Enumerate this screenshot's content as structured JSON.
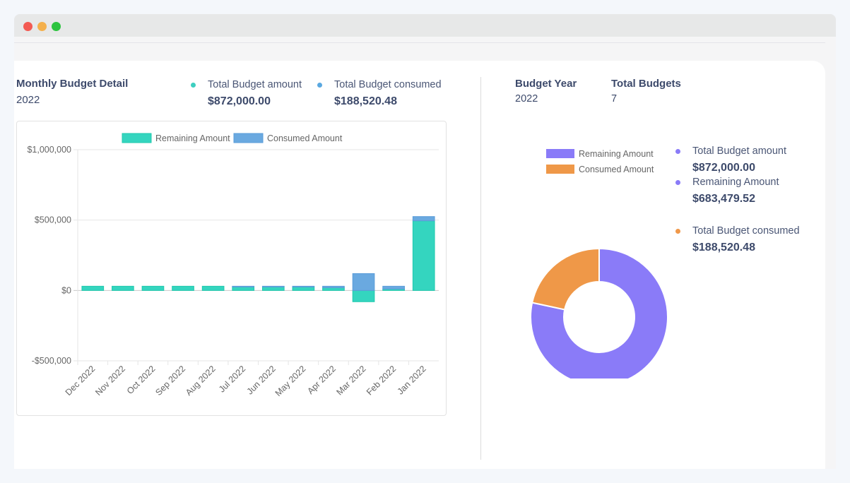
{
  "window": {
    "controls": [
      "close",
      "minimize",
      "maximize"
    ]
  },
  "left_panel": {
    "title": "Monthly Budget Detail",
    "year": "2022",
    "stats": [
      {
        "label": "Total Budget amount",
        "value": "$872,000.00",
        "dot_color": "#3ecfc0"
      },
      {
        "label": "Total Budget consumed",
        "value": "$188,520.48",
        "dot_color": "#5aa8e0"
      }
    ]
  },
  "right_panel": {
    "budget_year_label": "Budget Year",
    "budget_year_value": "2022",
    "total_budgets_label": "Total Budgets",
    "total_budgets_value": "7",
    "stats": [
      {
        "label": "Total Budget amount",
        "value": "$872,000.00",
        "dot_color": "#8a7bf8"
      },
      {
        "label": "Remaining Amount",
        "value": "$683,479.52",
        "dot_color": "#8a7bf8"
      },
      {
        "label": "Total Budget consumed",
        "value": "$188,520.48",
        "dot_color": "#f0984a"
      }
    ]
  },
  "chart_data": [
    {
      "type": "bar",
      "stacked": true,
      "title": "",
      "xlabel": "",
      "ylabel": "",
      "categories": [
        "Dec 2022",
        "Nov 2022",
        "Oct 2022",
        "Sep 2022",
        "Aug 2022",
        "Jul 2022",
        "Jun 2022",
        "May 2022",
        "Apr 2022",
        "Mar 2022",
        "Feb 2022",
        "Jan 2022"
      ],
      "series": [
        {
          "name": "Remaining Amount",
          "color": "#34d5bf",
          "border": "#1fc9ae",
          "values": [
            30000,
            30000,
            30000,
            30000,
            30000,
            28000,
            28000,
            25000,
            20000,
            -80000,
            10000,
            495000
          ]
        },
        {
          "name": "Consumed Amount",
          "color": "#6aa9e0",
          "border": "#5b9dd9",
          "values": [
            0,
            0,
            0,
            0,
            0,
            2000,
            2000,
            5000,
            10000,
            120000,
            20000,
            30000
          ]
        }
      ],
      "ylim": [
        -500000,
        1000000
      ],
      "yticks": [
        1000000,
        500000,
        0,
        -500000
      ],
      "ytick_labels": [
        "$1,000,000",
        "$500,000",
        "$0",
        "-$500,000"
      ],
      "legend": "top",
      "grid": true
    },
    {
      "type": "pie",
      "donut": true,
      "labels": [
        "Remaining Amount",
        "Consumed Amount"
      ],
      "values": [
        683479.52,
        188520.48
      ],
      "colors": [
        "#8a7bf8",
        "#ef9848"
      ],
      "legend": "top-left"
    }
  ]
}
